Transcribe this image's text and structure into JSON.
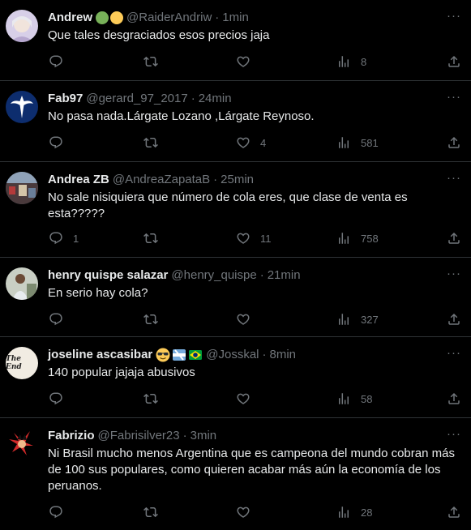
{
  "replies": [
    {
      "name": "Andrew",
      "handle": "@RaiderAndriw",
      "sep": "·",
      "time": "1min",
      "text": "Que tales desgraciados esos precios jaja",
      "reply_count": "",
      "like_count": "",
      "views": "8",
      "badges": [
        "green-circle-emoji",
        "yellow-circle-emoji"
      ]
    },
    {
      "name": "Fab97",
      "handle": "@gerard_97_2017",
      "sep": "·",
      "time": "24min",
      "text": "No pasa nada.Lárgate Lozano ,Lárgate Reynoso.",
      "reply_count": "",
      "like_count": "4",
      "views": "581"
    },
    {
      "name": "Andrea ZB",
      "handle": "@AndreaZapataB",
      "sep": "·",
      "time": "25min",
      "text": "No sale nisiquiera que número de cola eres, que clase de venta es esta?????",
      "reply_count": "1",
      "like_count": "11",
      "views": "758"
    },
    {
      "name": "henry quispe salazar",
      "handle": "@henry_quispe",
      "sep": "·",
      "time": "21min",
      "text": "En serio hay cola?",
      "reply_count": "",
      "like_count": "",
      "views": "327"
    },
    {
      "name": "joseline ascasibar",
      "handle": "@Josskal",
      "sep": "·",
      "time": "8min",
      "text": "140 popular jajaja abusivos",
      "reply_count": "",
      "like_count": "",
      "views": "58",
      "badges": [
        "sunglasses-emoji",
        "argentina-flag-emoji",
        "brazil-flag-emoji"
      ]
    },
    {
      "name": "Fabrizio",
      "handle": "@Fabrisilver23",
      "sep": "·",
      "time": "3min",
      "text": "Ni Brasil mucho menos Argentina que es campeona del mundo cobran más de 100 sus populares, como quieren acabar más aún la economía de los peruanos.",
      "reply_count": "",
      "like_count": "",
      "views": "28"
    }
  ],
  "avatar_text": {
    "joseline": "The End"
  },
  "more_label": "···",
  "colors": {
    "background": "#000000",
    "text": "#e7e9ea",
    "secondary": "#71767b",
    "divider": "#2f3336"
  },
  "icons": [
    "reply-icon",
    "retweet-icon",
    "like-icon",
    "views-icon",
    "share-icon",
    "more-icon"
  ]
}
